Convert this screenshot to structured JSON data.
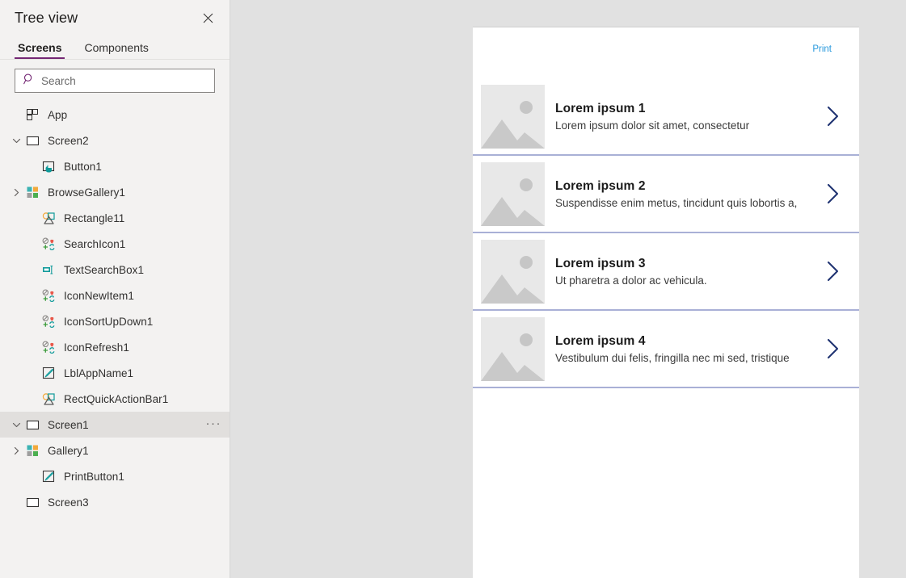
{
  "panel": {
    "title": "Tree view",
    "close_icon": "close-icon",
    "tabs": [
      {
        "label": "Screens",
        "active": true
      },
      {
        "label": "Components",
        "active": false
      }
    ],
    "search": {
      "placeholder": "Search",
      "value": "",
      "icon": "search-icon"
    },
    "tree": [
      {
        "label": "App",
        "icon": "app-grid-icon",
        "level": 0,
        "chevron": "none",
        "selected": false,
        "menu": false
      },
      {
        "label": "Screen2",
        "icon": "screen-icon",
        "level": 0,
        "chevron": "down",
        "selected": false,
        "menu": false
      },
      {
        "label": "Button1",
        "icon": "button-icon",
        "level": 2,
        "chevron": "none",
        "selected": false,
        "menu": false
      },
      {
        "label": "BrowseGallery1",
        "icon": "gallery-icon",
        "level": 1,
        "chevron": "right",
        "selected": false,
        "menu": false
      },
      {
        "label": "Rectangle11",
        "icon": "shapes-icon",
        "level": 2,
        "chevron": "none",
        "selected": false,
        "menu": false
      },
      {
        "label": "SearchIcon1",
        "icon": "icons-group-icon",
        "level": 2,
        "chevron": "none",
        "selected": false,
        "menu": false
      },
      {
        "label": "TextSearchBox1",
        "icon": "text-input-icon",
        "level": 2,
        "chevron": "none",
        "selected": false,
        "menu": false
      },
      {
        "label": "IconNewItem1",
        "icon": "icons-group-icon",
        "level": 2,
        "chevron": "none",
        "selected": false,
        "menu": false
      },
      {
        "label": "IconSortUpDown1",
        "icon": "icons-group-icon",
        "level": 2,
        "chevron": "none",
        "selected": false,
        "menu": false
      },
      {
        "label": "IconRefresh1",
        "icon": "icons-group-icon",
        "level": 2,
        "chevron": "none",
        "selected": false,
        "menu": false
      },
      {
        "label": "LblAppName1",
        "icon": "label-icon",
        "level": 2,
        "chevron": "none",
        "selected": false,
        "menu": false
      },
      {
        "label": "RectQuickActionBar1",
        "icon": "shapes-icon",
        "level": 2,
        "chevron": "none",
        "selected": false,
        "menu": false
      },
      {
        "label": "Screen1",
        "icon": "screen-icon",
        "level": 0,
        "chevron": "down",
        "selected": true,
        "menu": true,
        "menu_label": "···"
      },
      {
        "label": "Gallery1",
        "icon": "gallery-icon",
        "level": 1,
        "chevron": "right",
        "selected": false,
        "menu": false
      },
      {
        "label": "PrintButton1",
        "icon": "label-icon",
        "level": 2,
        "chevron": "none",
        "selected": false,
        "menu": false
      },
      {
        "label": "Screen3",
        "icon": "screen-icon",
        "level": 1,
        "chevron": "none",
        "selected": false,
        "menu": false
      }
    ]
  },
  "canvas": {
    "print_link": "Print",
    "gallery_items": [
      {
        "title": "Lorem ipsum 1",
        "subtitle": "Lorem ipsum dolor sit amet, consectetur"
      },
      {
        "title": "Lorem ipsum 2",
        "subtitle": "Suspendisse enim metus, tincidunt quis lobortis a,"
      },
      {
        "title": "Lorem ipsum 3",
        "subtitle": "Ut pharetra a dolor ac vehicula."
      },
      {
        "title": "Lorem ipsum 4",
        "subtitle": "Vestibulum dui felis, fringilla nec mi sed, tristique"
      }
    ]
  },
  "colors": {
    "accent_purple": "#742774",
    "link_blue": "#2899dd",
    "chevron_navy": "#1f3372",
    "divider_periwinkle": "#a9b0d6",
    "panel_bg": "#f3f2f1",
    "canvas_bg": "#e1e1e1"
  }
}
